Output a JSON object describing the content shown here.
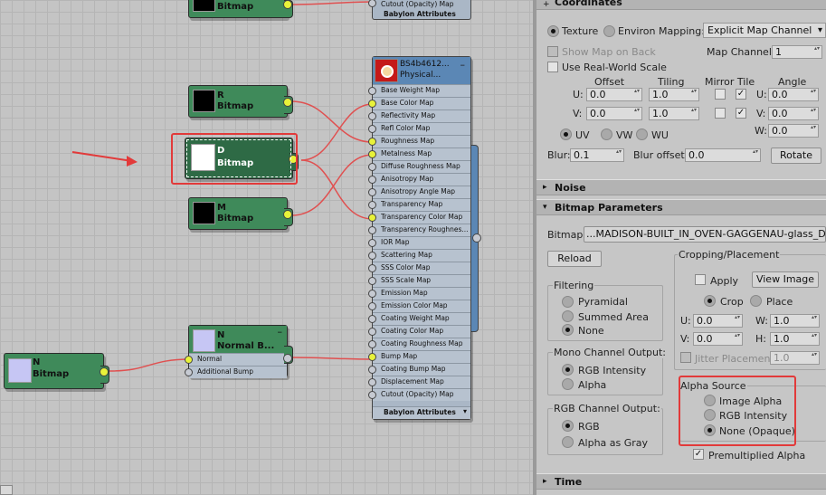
{
  "graph": {
    "nodes": {
      "top_bitmap": {
        "label": "Bitmap"
      },
      "r_bitmap": {
        "name": "R",
        "label": "Bitmap"
      },
      "d_bitmap": {
        "name": "D",
        "label": "Bitmap"
      },
      "m_bitmap": {
        "name": "M",
        "label": "Bitmap"
      },
      "normal_bump": {
        "name": "N",
        "label": "Normal B...",
        "inputs": [
          "Normal",
          "Additional Bump"
        ]
      },
      "n_bitmap": {
        "name": "N",
        "label": "Bitmap"
      }
    },
    "top_stub": [
      "Cutout (Opacity) Map",
      "Babylon Attributes"
    ],
    "material": {
      "title": "BS4b4612...",
      "subtitle": "Physical...",
      "slots": [
        "Base Weight Map",
        "Base Color Map",
        "Reflectivity Map",
        "Refl Color Map",
        "Roughness Map",
        "Metalness Map",
        "Diffuse Roughness Map",
        "Anisotropy Map",
        "Anisotropy Angle Map",
        "Transparency Map",
        "Transparency Color Map",
        "Transparency Roughnes...",
        "IOR Map",
        "Scattering Map",
        "SSS Color Map",
        "SSS Scale Map",
        "Emission Map",
        "Emission Color Map",
        "Coating Weight Map",
        "Coating Color Map",
        "Coating Roughness Map",
        "Bump Map",
        "Coating Bump Map",
        "Displacement Map",
        "Cutout (Opacity) Map"
      ],
      "footer": "Babylon Attributes",
      "connected": [
        1,
        4,
        5,
        10,
        21
      ]
    }
  },
  "panel": {
    "coordinates": {
      "title": "Coordinates",
      "texture": "Texture",
      "environ": "Environ",
      "mapping_label": "Mapping:",
      "mapping_value": "Explicit Map Channel",
      "show_map": "Show Map on Back",
      "map_channel_label": "Map Channel:",
      "map_channel": "1",
      "real_world": "Use Real-World Scale",
      "offset": "Offset",
      "tiling": "Tiling",
      "mirror_tile": "Mirror Tile",
      "angle": "Angle",
      "u": "U:",
      "v": "V:",
      "w": "W:",
      "u_offset": "0.0",
      "v_offset": "0.0",
      "u_tiling": "1.0",
      "v_tiling": "1.0",
      "u_angle": "0.0",
      "v_angle": "0.0",
      "w_angle": "0.0",
      "uv": "UV",
      "vw": "VW",
      "wu": "WU",
      "blur_label": "Blur:",
      "blur": "0.1",
      "blur_offset_label": "Blur offset:",
      "blur_offset": "0.0",
      "rotate": "Rotate"
    },
    "noise": {
      "title": "Noise"
    },
    "bitmap_params": {
      "title": "Bitmap Parameters",
      "bitmap_label": "Bitmap:",
      "bitmap_path": "...MADISON-BUILT_IN_OVEN-GAGGENAU-glass_D.png",
      "reload": "Reload",
      "filtering": "Filtering",
      "pyramidal": "Pyramidal",
      "summed_area": "Summed Area",
      "none": "None",
      "mono_output": "Mono Channel Output:",
      "rgb_intensity": "RGB Intensity",
      "alpha": "Alpha",
      "rgb_output": "RGB Channel Output:",
      "rgb": "RGB",
      "alpha_as_gray": "Alpha as Gray",
      "cropping": "Cropping/Placement",
      "apply": "Apply",
      "view_image": "View Image",
      "crop": "Crop",
      "place": "Place",
      "u_label": "U:",
      "u_val": "0.0",
      "w_label": "W:",
      "w_val": "1.0",
      "v_label": "V:",
      "v_val": "0.0",
      "h_label": "H:",
      "h_val": "1.0",
      "jitter": "Jitter Placement:",
      "jitter_val": "1.0",
      "alpha_source": "Alpha Source",
      "image_alpha": "Image Alpha",
      "rgb_intensity2": "RGB Intensity",
      "none_opaque": "None (Opaque)",
      "premultiplied": "Premultiplied Alpha"
    },
    "time": {
      "title": "Time"
    }
  },
  "colors": {
    "node_green": "#3f8a5a",
    "material_blue": "#5b87b5",
    "wire_red": "#e05050",
    "highlight_red": "#e23a3a",
    "socket_yellow": "#e8f23a"
  }
}
